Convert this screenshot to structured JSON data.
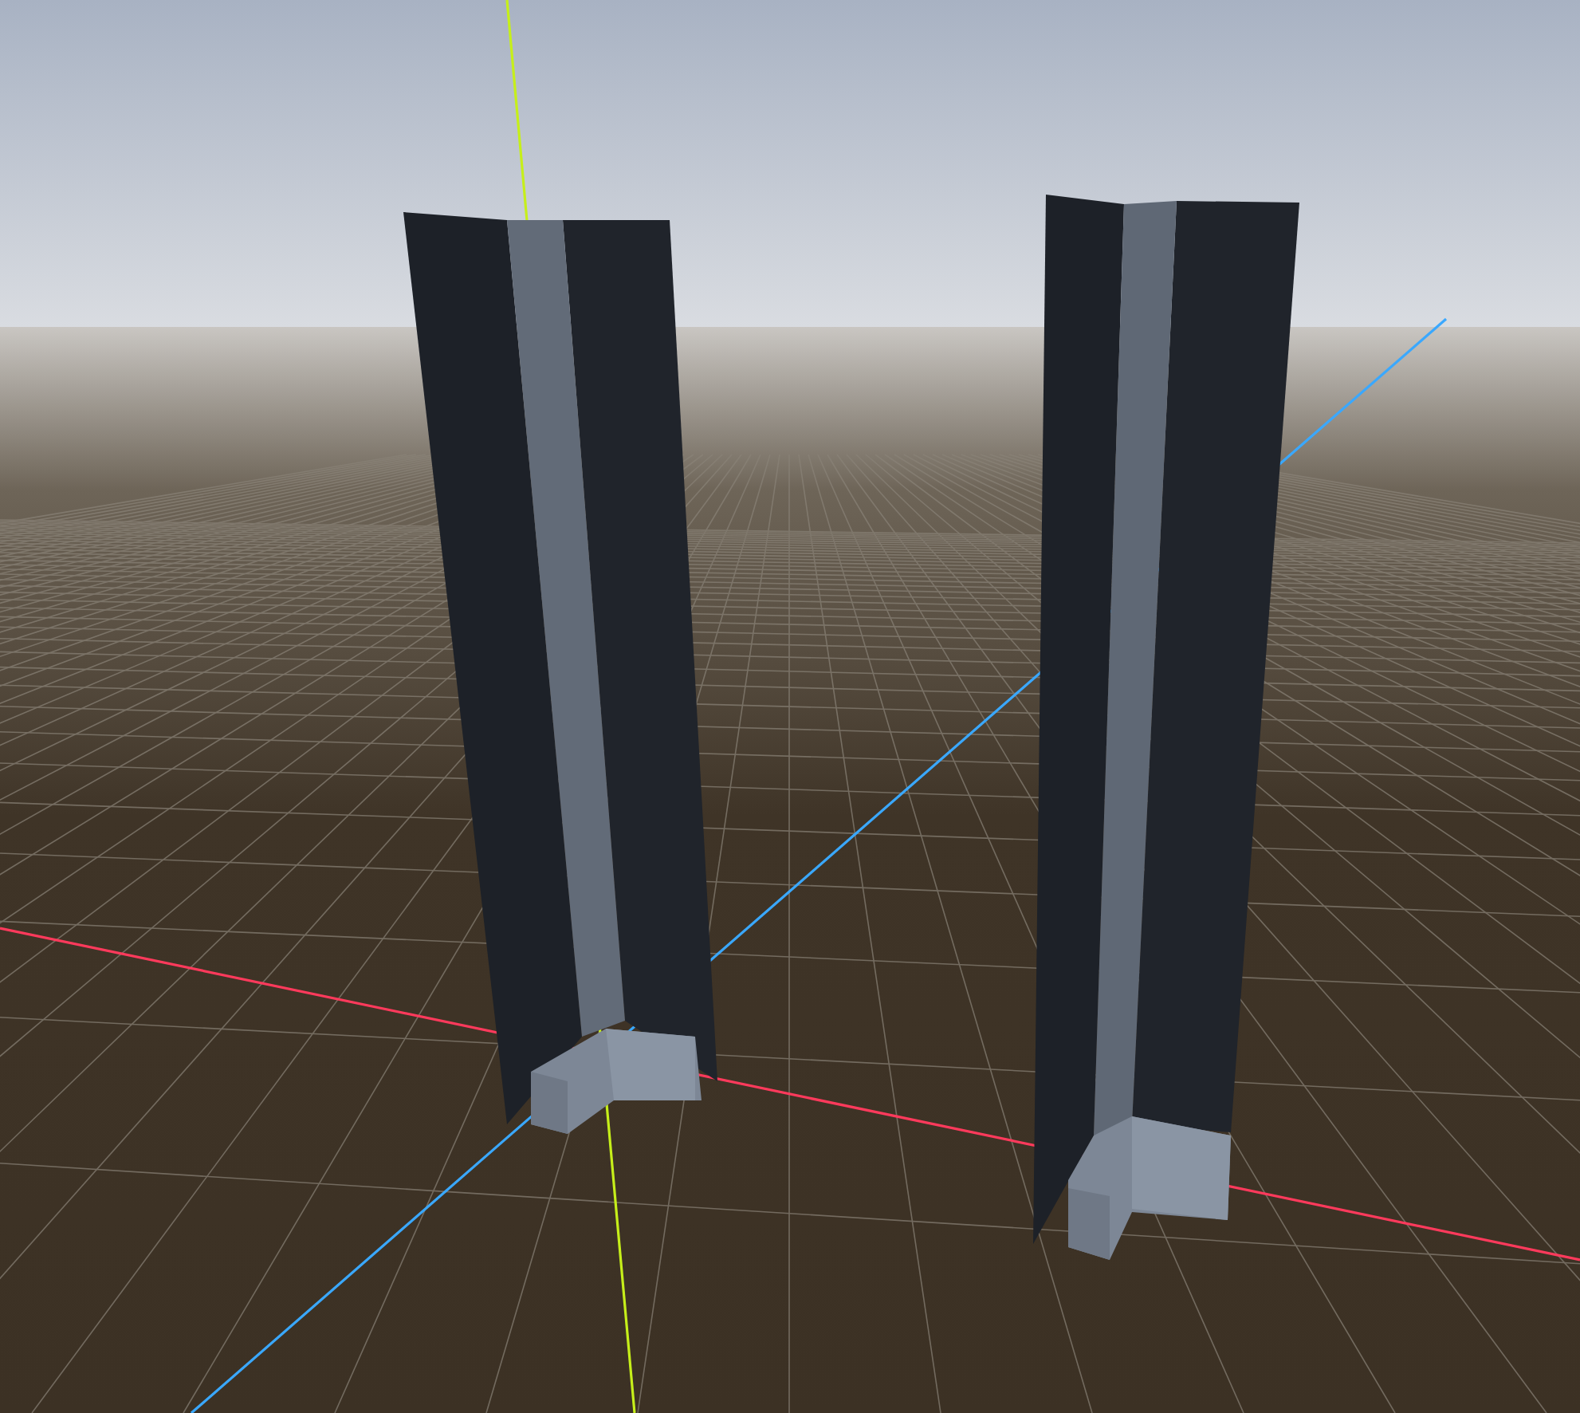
{
  "viewport": {
    "axes": [
      {
        "kind": "x",
        "color": "#ff3a5c"
      },
      {
        "kind": "y",
        "color": "#c6ef1a"
      },
      {
        "kind": "z",
        "color": "#3aa8ff"
      }
    ]
  }
}
